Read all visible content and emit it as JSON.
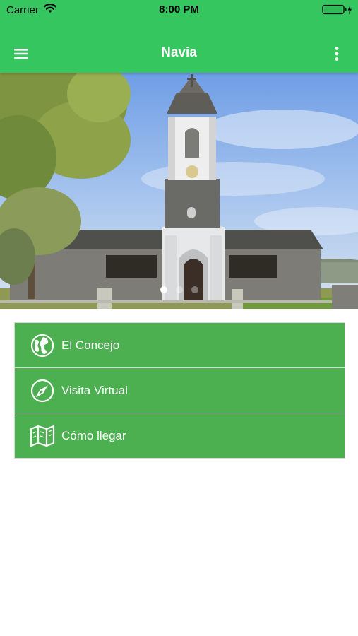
{
  "status_bar": {
    "carrier": "Carrier",
    "time": "8:00 PM",
    "wifi_icon": "wifi-icon",
    "battery_icon": "battery-charging-icon"
  },
  "app_bar": {
    "title": "Navia",
    "menu_icon": "hamburger-menu-icon",
    "more_icon": "more-vertical-icon",
    "background_color": "#35c65f"
  },
  "carousel": {
    "slide_count": 3,
    "active_index": 0
  },
  "menu": {
    "items": [
      {
        "label": "El Concejo",
        "icon": "globe-icon"
      },
      {
        "label": "Visita Virtual",
        "icon": "compass-icon"
      },
      {
        "label": "Cómo llegar",
        "icon": "map-icon"
      }
    ],
    "background_color": "#4caf50"
  }
}
